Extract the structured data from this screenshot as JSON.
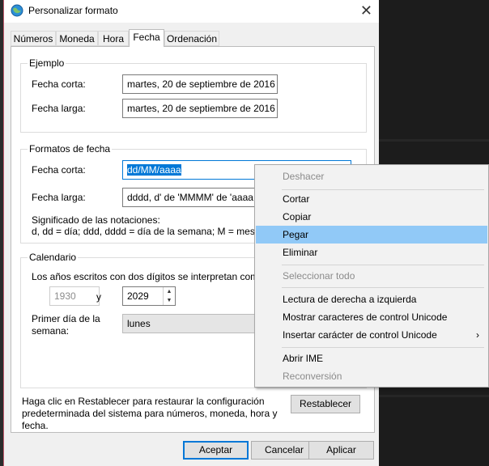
{
  "window": {
    "title": "Personalizar formato",
    "close_glyph": "✕"
  },
  "tabs": [
    {
      "label": "Números"
    },
    {
      "label": "Moneda"
    },
    {
      "label": "Hora"
    },
    {
      "label": "Fecha"
    },
    {
      "label": "Ordenación"
    }
  ],
  "ejemplo": {
    "legend": "Ejemplo",
    "short_label": "Fecha corta:",
    "short_value": "martes, 20 de septiembre de 2016",
    "long_label": "Fecha larga:",
    "long_value": "martes, 20 de septiembre de 2016"
  },
  "formatos": {
    "legend": "Formatos de fecha",
    "short_label": "Fecha corta:",
    "short_value": "dd/MM/aaaa",
    "long_label": "Fecha larga:",
    "long_value": "dddd, d' de 'MMMM' de 'aaaa",
    "notation_title": "Significado de las notaciones:",
    "notation_text": "d, dd = día;  ddd, dddd = día de la semana; M = mes;"
  },
  "calendario": {
    "legend": "Calendario",
    "two_digit_text": "Los años escritos con dos dígitos se interpretan como",
    "year_from": "1930",
    "year_and": "y",
    "year_to": "2029",
    "first_day_label_1": "Primer día de la",
    "first_day_label_2": "semana:",
    "first_day_value": "lunes"
  },
  "footer": {
    "reset_text_1": "Haga clic en Restablecer para restaurar la configuración",
    "reset_text_2": "predeterminada del sistema para números, moneda, hora y",
    "reset_text_3": "fecha.",
    "reset_button": "Restablecer",
    "accept_button": "Aceptar",
    "cancel_button": "Cancelar",
    "apply_button": "Aplicar"
  },
  "context_menu": {
    "items": [
      {
        "label": "Deshacer",
        "enabled": false
      },
      {
        "label": "Cortar",
        "enabled": true
      },
      {
        "label": "Copiar",
        "enabled": true
      },
      {
        "label": "Pegar",
        "enabled": true,
        "highlighted": true
      },
      {
        "label": "Eliminar",
        "enabled": true
      },
      {
        "label": "Seleccionar todo",
        "enabled": false
      },
      {
        "label": "Lectura de derecha a izquierda",
        "enabled": true
      },
      {
        "label": "Mostrar caracteres de control Unicode",
        "enabled": true
      },
      {
        "label": "Insertar carácter de control Unicode",
        "enabled": true,
        "submenu": true
      },
      {
        "label": "Abrir IME",
        "enabled": true
      },
      {
        "label": "Reconversión",
        "enabled": false
      }
    ],
    "submenu_glyph": "›"
  },
  "colors": {
    "selection": "#0078d7",
    "menu_highlight": "#91c9f7"
  }
}
